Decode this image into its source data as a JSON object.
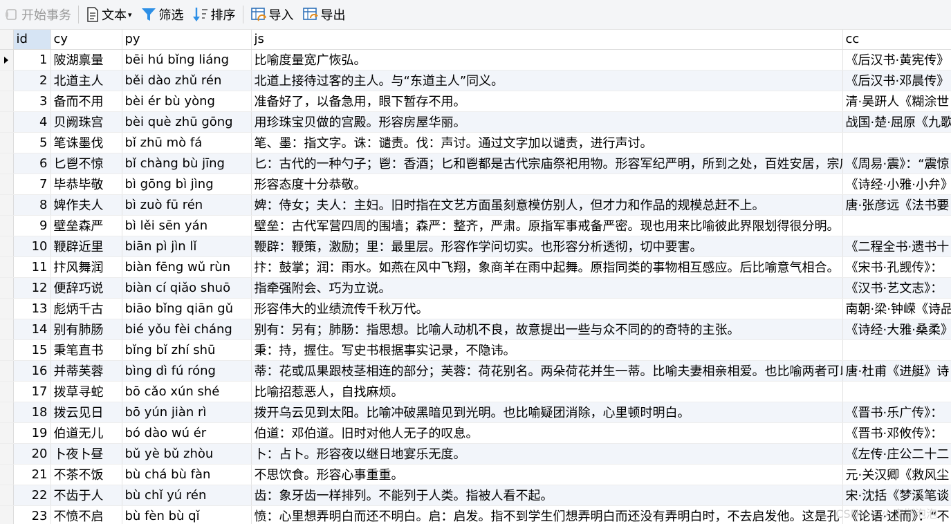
{
  "toolbar": {
    "begin_transaction": "开始事务",
    "text": "文本",
    "filter": "筛选",
    "sort": "排序",
    "import": "导入",
    "export": "导出"
  },
  "columns": [
    "id",
    "cy",
    "py",
    "js",
    "cc"
  ],
  "rows": [
    {
      "id": "1",
      "cy": "陂湖禀量",
      "py": "bēi hú bǐng liáng",
      "js": "比喻度量宽广恢弘。",
      "cc": "《后汉书·黄宪传》"
    },
    {
      "id": "2",
      "cy": "北道主人",
      "py": "běi dào zhǔ rén",
      "js": "北道上接待过客的主人。与“东道主人”同义。",
      "cc": "《后汉书·邓晨传》"
    },
    {
      "id": "3",
      "cy": "备而不用",
      "py": "bèi ér bù yòng",
      "js": "准备好了，以备急用，眼下暂存不用。",
      "cc": "清·吴趼人《糊涂世"
    },
    {
      "id": "4",
      "cy": "贝阙珠宫",
      "py": "bèi què zhū gōng",
      "js": "用珍珠宝贝做的宫殿。形容房屋华丽。",
      "cc": "战国·楚·屈原《九歌"
    },
    {
      "id": "5",
      "cy": "笔诛墨伐",
      "py": "bǐ zhū mò fá",
      "js": "笔、墨：指文字。诛：谴责。伐：声讨。通过文字加以谴责，进行声讨。",
      "cc": ""
    },
    {
      "id": "6",
      "cy": "匕鬯不惊",
      "py": "bǐ chàng bù jīng",
      "js": "匕：古代的一种勺子；鬯：香酒；匕和鬯都是古代宗庙祭祀用物。形容军纪严明，所到之处，百姓安居，宗庙",
      "cc": "《周易·震》：“震惊"
    },
    {
      "id": "7",
      "cy": "毕恭毕敬",
      "py": "bì gōng bì jìng",
      "js": "形容态度十分恭敬。",
      "cc": "《诗经·小雅·小弁》"
    },
    {
      "id": "8",
      "cy": "婢作夫人",
      "py": "bì zuò fū rén",
      "js": "婢：侍女；夫人：主妇。旧时指在文艺方面虽刻意模仿别人，但才力和作品的规模总赶不上。",
      "cc": "唐·张彦远《法书要"
    },
    {
      "id": "9",
      "cy": "壁垒森严",
      "py": "bì lěi sēn yán",
      "js": "壁垒：古代军营四周的围墙；森严：整齐，严肃。原指军事戒备严密。现也用来比喻彼此界限划得很分明。",
      "cc": ""
    },
    {
      "id": "10",
      "cy": "鞭辟近里",
      "py": "biān pì jìn lǐ",
      "js": "鞭辟：鞭策，激励；里：最里层。形容作学问切实。也形容分析透彻，切中要害。",
      "cc": "《二程全书·遗书十"
    },
    {
      "id": "11",
      "cy": "抃风舞润",
      "py": "biàn fēng wǔ rùn",
      "js": "抃：鼓掌；润：雨水。如燕在风中飞翔，象商羊在雨中起舞。原指同类的事物相互感应。后比喻意气相合。",
      "cc": "《宋书·孔觊传》："
    },
    {
      "id": "12",
      "cy": "便辞巧说",
      "py": "biàn cí qiǎo shuō",
      "js": "指牵强附会、巧为立说。",
      "cc": "《汉书·艺文志》："
    },
    {
      "id": "13",
      "cy": "彪炳千古",
      "py": "biāo bǐng qiān gǔ",
      "js": "形容伟大的业绩流传千秋万代。",
      "cc": "南朝·梁·钟嵘《诗品"
    },
    {
      "id": "14",
      "cy": "别有肺肠",
      "py": "bié yǒu fèi cháng",
      "js": "别有：另有；肺肠：指思想。比喻人动机不良，故意提出一些与众不同的的奇特的主张。",
      "cc": "《诗经·大雅·桑柔》"
    },
    {
      "id": "15",
      "cy": "秉笔直书",
      "py": "bǐng bǐ zhí shū",
      "js": "秉：持，握住。写史书根据事实记录，不隐讳。",
      "cc": ""
    },
    {
      "id": "16",
      "cy": "并蒂芙蓉",
      "py": "bìng dì fú róng",
      "js": "蒂：花或瓜果跟枝茎相连的部分；芙蓉：荷花别名。两朵荷花并生一蒂。比喻夫妻相亲相爱。也比喻两者可以",
      "cc": "唐·杜甫《进艇》诗"
    },
    {
      "id": "17",
      "cy": "拨草寻蛇",
      "py": "bō cǎo xún shé",
      "js": "比喻招惹恶人，自找麻烦。",
      "cc": ""
    },
    {
      "id": "18",
      "cy": "拨云见日",
      "py": "bō yún jiàn rì",
      "js": "拨开乌云见到太阳。比喻冲破黑暗见到光明。也比喻疑团消除，心里顿时明白。",
      "cc": "《晋书·乐广传》："
    },
    {
      "id": "19",
      "cy": "伯道无儿",
      "py": "bó dào wú ér",
      "js": "伯道：邓伯道。旧时对他人无子的叹息。",
      "cc": "《晋书·邓攸传》："
    },
    {
      "id": "20",
      "cy": "卜夜卜昼",
      "py": "bǔ yè bǔ zhòu",
      "js": "卜：占卜。形容夜以继日地宴乐无度。",
      "cc": "《左传·庄公二十二"
    },
    {
      "id": "21",
      "cy": "不茶不饭",
      "py": "bù chá bù fàn",
      "js": "不思饮食。形容心事重重。",
      "cc": "元·关汉卿《救风尘"
    },
    {
      "id": "22",
      "cy": "不齿于人",
      "py": "bù chǐ yú rén",
      "js": "齿：象牙齿一样排列。不能列于人类。指被人看不起。",
      "cc": "宋·沈括《梦溪笔谈"
    },
    {
      "id": "23",
      "cy": "不愤不启",
      "py": "bù fèn bù qǐ",
      "js": "愤：心里想弄明白而还不明白。启：启发。指不到学生们想弄明白而还没有弄明白时，不去启发他。这是孔",
      "cc": "《论语·述而》：“不"
    }
  ],
  "watermark": "CSDN @火克斯泡泡"
}
